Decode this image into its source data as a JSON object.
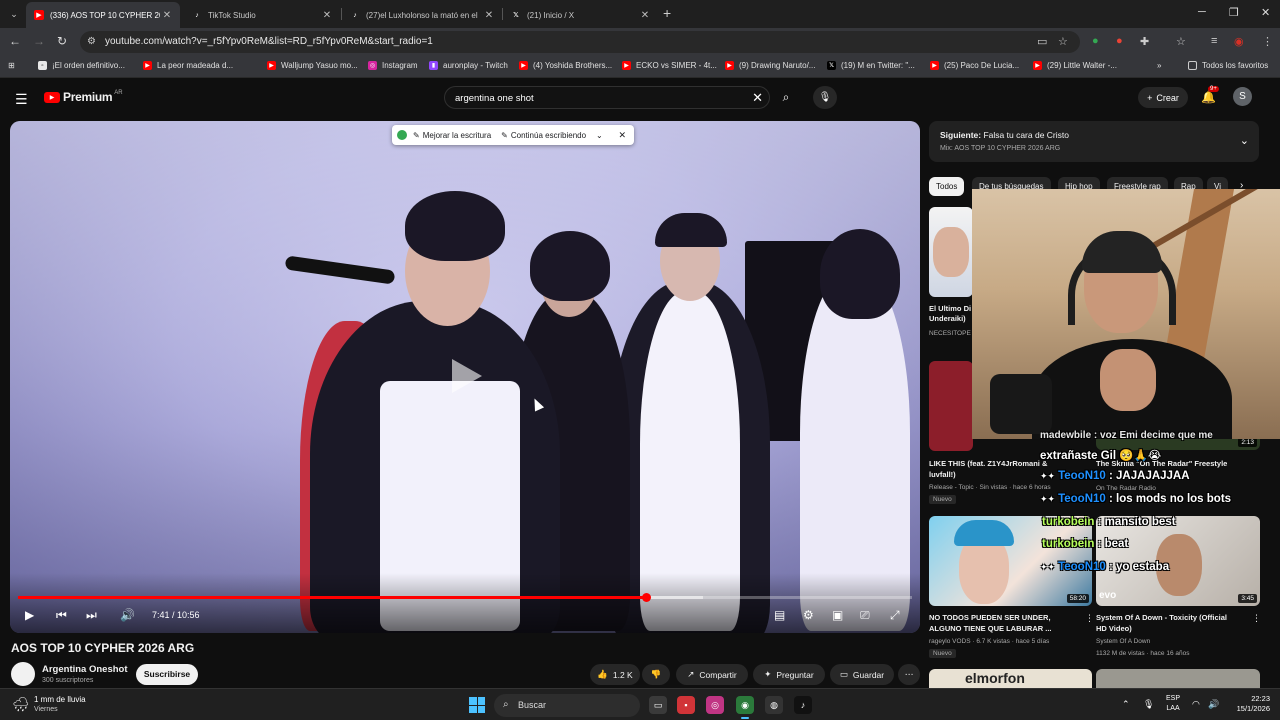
{
  "browser": {
    "tabs": [
      {
        "title": "(336) AOS TOP 10 CYPHER 2026",
        "icon": "youtube-icon"
      },
      {
        "title": "TikTok Studio",
        "icon": "tiktok-icon"
      },
      {
        "title": "(27)el Luxholonso la mató en el",
        "icon": "tiktok-icon"
      },
      {
        "title": "(21) Inicio / X",
        "icon": "x-icon"
      }
    ],
    "url": "youtube.com/watch?v=_r5fYpv0ReM&list=RD_r5fYpv0ReM&start_radio=1",
    "bookmarks": [
      "¡El orden definitivo...",
      "La peor madeada d...",
      "Walljump Yasuo mo...",
      "Instagram",
      "auronplay - Twitch",
      "(4) Yoshida Brothers...",
      "ECKO vs SIMER - 4t...",
      "(9) Drawing Naruto/...",
      "(19) M en Twitter: \"...",
      "(25) Paco De Lucia...",
      "(29) Little Walter -..."
    ],
    "all_bookmarks": "Todos los favoritos"
  },
  "youtube": {
    "logo_text": "Premium",
    "region": "AR",
    "search_query": "argentina one shot",
    "create_label": "Crear",
    "notifications": "9+",
    "avatar_letter": "S"
  },
  "writer_popup": {
    "improve": "Mejorar la escritura",
    "continue": "Continúa escribiendo"
  },
  "player": {
    "time": "7:41 / 10:56",
    "progress": 0.703,
    "buffered": 0.766
  },
  "video": {
    "title": "AOS TOP 10 CYPHER 2026 ARG",
    "channel": "Argentina Oneshot",
    "subscribers": "300 suscriptores",
    "subscribe": "Suscribirse",
    "likes": "1.2 K",
    "share": "Compartir",
    "ask": "Preguntar",
    "save": "Guardar"
  },
  "next_up": {
    "label": "Siguiente:",
    "title": "Falsa tu cara de Cristo",
    "mix": "Mix: AOS TOP 10 CYPHER 2026 ARG"
  },
  "chips": [
    "Todos",
    "De tus búsquedas",
    "Hip hop",
    "Freestyle rap",
    "Rap",
    "Vi"
  ],
  "recommendations": [
    {
      "title": "El Ultimo Di",
      "title2": "Underaiki)",
      "meta": "NECESITOPE",
      "duration": ""
    },
    {
      "title": "LIKE THIS (feat. Z1Y4JrRomani &",
      "title2": "luvfall!)",
      "meta": "Release - Topic · Sin vistas · hace 6 horas",
      "badge": "Nuevo",
      "duration": ""
    },
    {
      "title": "The Skrilla \"On The Radar\" Freestyle",
      "meta": "On The Radar Radio",
      "duration": "2:13"
    },
    {
      "title": "NO TODOS PUEDEN SER UNDER,",
      "title2": "ALGUNO TIENE QUE LABURAR ...",
      "meta": "rageylo VODS · 6.7 K vistas · hace 5 días",
      "badge": "Nuevo",
      "duration": "58:20"
    },
    {
      "title": "System Of A Down - Toxicity (Official",
      "title2": "HD Video)",
      "meta": "System Of A Down",
      "meta2": "1132 M de vistas · hace 16 años",
      "duration": "3:45"
    }
  ],
  "chat": [
    {
      "user": "",
      "text": "extrañaste Gil 🥺🙏😭"
    },
    {
      "user": "TeooN10",
      "text": ": JAJAJAJJAA"
    },
    {
      "user": "TeooN10",
      "text": ": los mods no los bots"
    },
    {
      "user": "turkobein",
      "text": ": mansito best"
    },
    {
      "user": "turkobein",
      "text": ": beat"
    },
    {
      "user": "TeooN10",
      "text": ": yo estaba"
    }
  ],
  "chat_partial": "madewbile : voz Emi decime que me",
  "thumb_text": {
    "elmorfon": "elmorfon",
    "evo": "evo"
  },
  "taskbar": {
    "weather": "1 mm de lluvia",
    "day": "Viernes",
    "search": "Buscar",
    "lang1": "ESP",
    "lang2": "LAA",
    "time": "22:23",
    "date": "15/1/2026"
  },
  "colors": {
    "accent": "#ff0000",
    "bg": "#0f0f0f",
    "chip_active": "#f1f1f1"
  }
}
